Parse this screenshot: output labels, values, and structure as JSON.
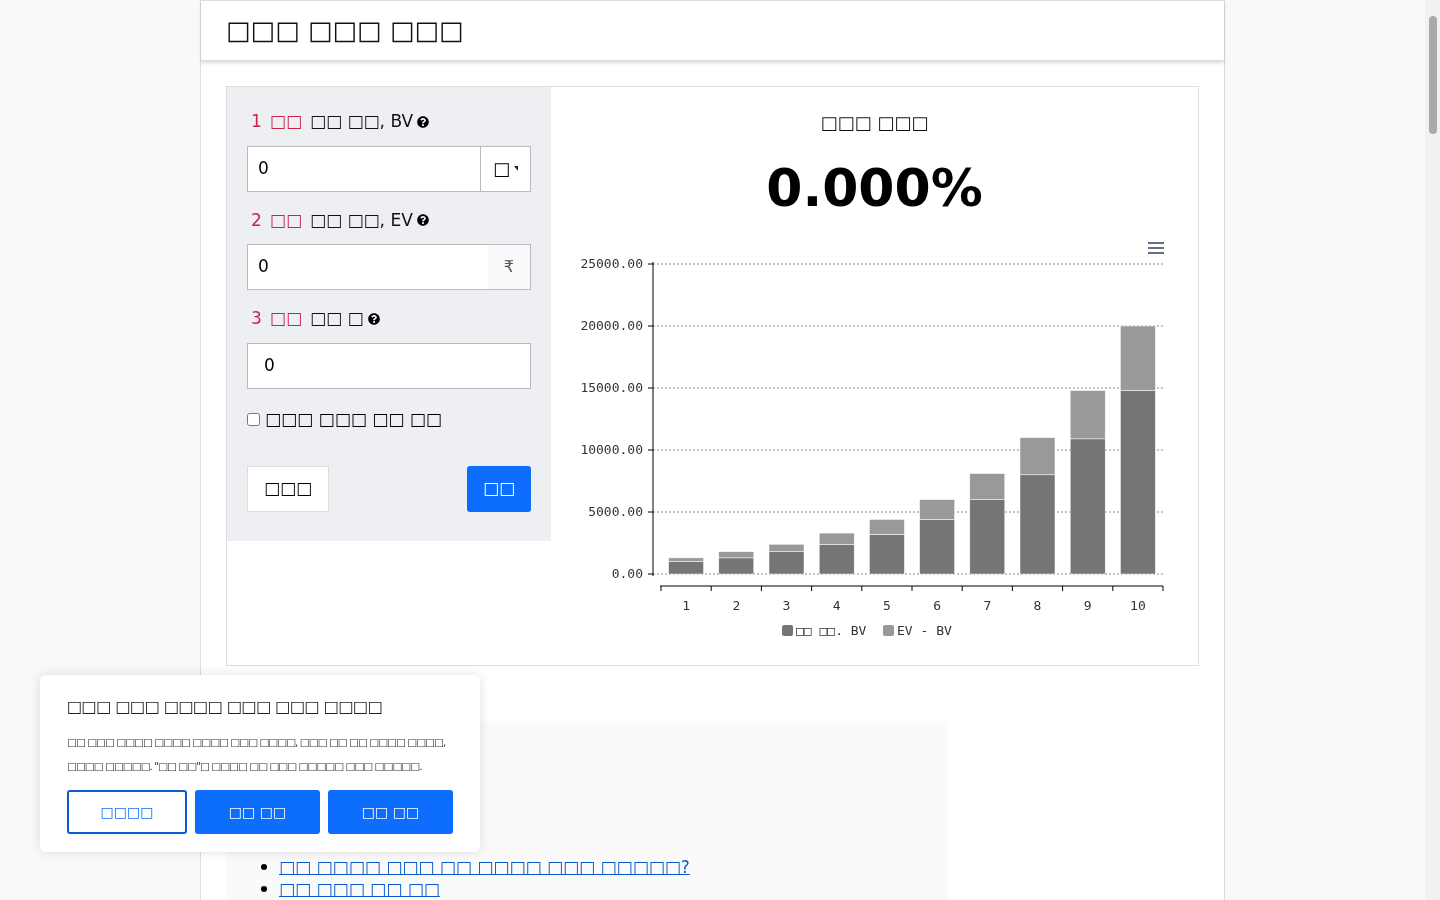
{
  "header": {
    "title": "□□□ □□□ □□□"
  },
  "form": {
    "fields": [
      {
        "number": "1",
        "step": "□□",
        "label": "□□ □□, BV",
        "value": "0",
        "kind": "dropdown",
        "addon": "□"
      },
      {
        "number": "2",
        "step": "□□",
        "label": "□□ □□, EV",
        "value": "0",
        "kind": "text",
        "addon": "₹"
      },
      {
        "number": "3",
        "step": "□□",
        "label": "□□ □",
        "value": "0",
        "kind": "none"
      }
    ],
    "checkbox": {
      "label": "□□□ □□□ □□ □□",
      "checked": false
    },
    "reset_button": "□□□",
    "calculate_button": "□□"
  },
  "result": {
    "title": "□□□ □□□",
    "value": "0.000%"
  },
  "chart_data": {
    "type": "bar",
    "stacked": true,
    "categories": [
      "1",
      "2",
      "3",
      "4",
      "5",
      "6",
      "7",
      "8",
      "9",
      "10"
    ],
    "series": [
      {
        "name": "□□ □□. BV",
        "color": "#757575",
        "values": [
          1000,
          1300,
          1800,
          2400,
          3200,
          4400,
          6000,
          8000,
          10900,
          14800
        ]
      },
      {
        "name": "EV - BV",
        "color": "#999999",
        "values": [
          300,
          500,
          600,
          900,
          1200,
          1600,
          2100,
          3000,
          3900,
          5200
        ]
      }
    ],
    "grid": true,
    "legend": true,
    "ylim": [
      0,
      25000
    ],
    "yticks": [
      {
        "value": 0,
        "label": "0.00"
      },
      {
        "value": 5000,
        "label": "5000.00"
      },
      {
        "value": 10000,
        "label": "10000.00"
      },
      {
        "value": 15000,
        "label": "15000.00"
      },
      {
        "value": 20000,
        "label": "20000.00"
      },
      {
        "value": 25000,
        "label": "25000.00"
      }
    ]
  },
  "links": [
    "□□ □□□□ □□□ □□ □□□□ □□□ □□□□□?",
    "□□ □□□ □□ □□"
  ],
  "cookie_notice": {
    "title": "□□□ □□□ □□□□ □□□ □□□ □□□□",
    "text": "□□ □□□ □□□□ □□□□ □□□□ □□□ □□□□, □□□ □□ □□ □□□□ □□□□, □□□□ □□□□□. \"□□ □□\"□ □□□□ □□ □□□ □□□□□ □□□ □□□□□.",
    "buttons": [
      "□□□□",
      "□□ □□",
      "□□ □□"
    ]
  }
}
